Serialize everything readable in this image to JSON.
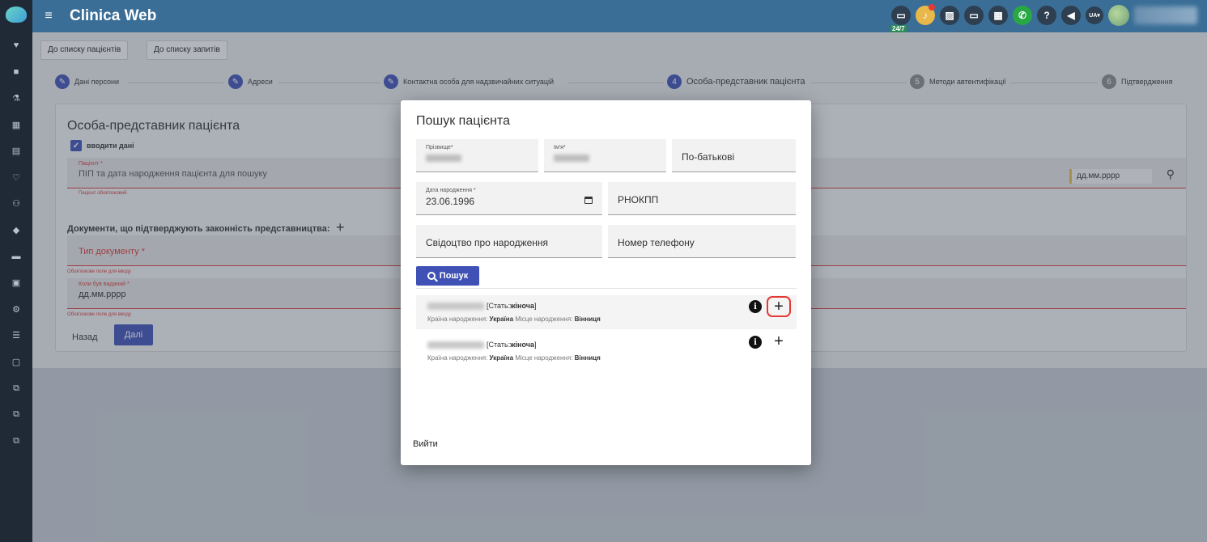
{
  "app": {
    "title": "Clinica Web"
  },
  "topbar": {
    "badge_247": "24/7",
    "lang": "UA▾"
  },
  "toolbar": {
    "to_patients": "До списку пацієнтів",
    "to_requests": "До списку запитів"
  },
  "stepper": [
    {
      "label": "Дані персони",
      "num": "",
      "state": "done"
    },
    {
      "label": "Адреси",
      "num": "",
      "state": "done"
    },
    {
      "label": "Контактна особа для надзвичайних ситуацій",
      "num": "",
      "state": "done"
    },
    {
      "label": "Особа-представник пацієнта",
      "num": "4",
      "state": "active"
    },
    {
      "label": "Методи автентифікації",
      "num": "5",
      "state": "todo"
    },
    {
      "label": "Підтвердження",
      "num": "6",
      "state": "todo"
    }
  ],
  "form": {
    "title": "Особа-представник пацієнта",
    "checkbox_label": "вводити дані",
    "patient_label": "Пацієнт *",
    "patient_placeholder": "ПІП та дата народження пацієнта для пошуку",
    "patient_error": "Пацієнт обов'язковий",
    "date_placeholder": "дд.мм.рррр",
    "docs_title": "Документи, що підтверджують законність представництва:",
    "doc_type_label": "Тип документу *",
    "doc_type_error": "Обов'язкове поле для вводу",
    "issued_label": "Коли був виданий *",
    "issued_value": "дд.мм.рррр",
    "issued_error": "Обов'язкове поле для вводу",
    "back": "Назад",
    "next": "Далі"
  },
  "modal": {
    "title": "Пошук пацієнта",
    "surname_label": "Прізвище*",
    "name_label": "Ім'я*",
    "patronymic_placeholder": "По-батькові",
    "dob_label": "Дата народження *",
    "dob_value": "23.06.1996",
    "rnokpp_placeholder": "РНОКПП",
    "birth_cert_placeholder": "Свідоцтво про народження",
    "phone_placeholder": "Номер телефону",
    "search_button": "Пошук",
    "exit": "Вийти",
    "results": [
      {
        "sex_prefix": "[Стать: ",
        "sex": "жіноча",
        "sex_suffix": " ]",
        "country_label": "Країна народження: ",
        "country": "Україна",
        "place_label": " Місце народження: ",
        "place": "Вінниця"
      },
      {
        "sex_prefix": "[Стать: ",
        "sex": "жіноча",
        "sex_suffix": " ]",
        "country_label": "Країна народження: ",
        "country": "Україна",
        "place_label": " Місце народження: ",
        "place": "Вінниця"
      }
    ]
  },
  "colors": {
    "topbar": "#3a6e96",
    "sidebar": "#1f2a36",
    "primary": "#3f51b5",
    "error": "#d63b3b",
    "highlight": "#e53935"
  }
}
